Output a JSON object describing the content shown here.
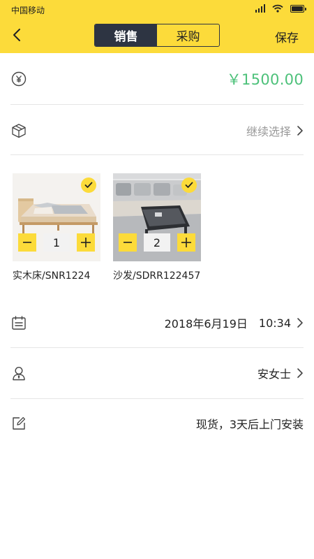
{
  "status_bar": {
    "carrier": "中国移动"
  },
  "header": {
    "tabs": [
      {
        "label": "销售",
        "active": true
      },
      {
        "label": "采购",
        "active": false
      }
    ],
    "save_label": "保存"
  },
  "amount": {
    "icon": "yuan-icon",
    "value": "￥1500.00",
    "color": "#4DC17A"
  },
  "products_row": {
    "icon": "package-icon",
    "value": "继续选择"
  },
  "products": [
    {
      "name": "实木床/SNR1224",
      "quantity": "1",
      "selected": true,
      "image": "bed-image"
    },
    {
      "name": "沙发/SDRR122457",
      "quantity": "2",
      "selected": true,
      "image": "sofa-image"
    }
  ],
  "date_row": {
    "icon": "calendar-icon",
    "date": "2018年6月19日",
    "time": "10:34"
  },
  "customer_row": {
    "icon": "person-icon",
    "value": "安女士"
  },
  "note_row": {
    "icon": "edit-icon",
    "value": "现货，3天后上门安装"
  },
  "colors": {
    "accent": "#FCDB3A",
    "dark": "#2D3442",
    "price": "#4DC17A"
  }
}
